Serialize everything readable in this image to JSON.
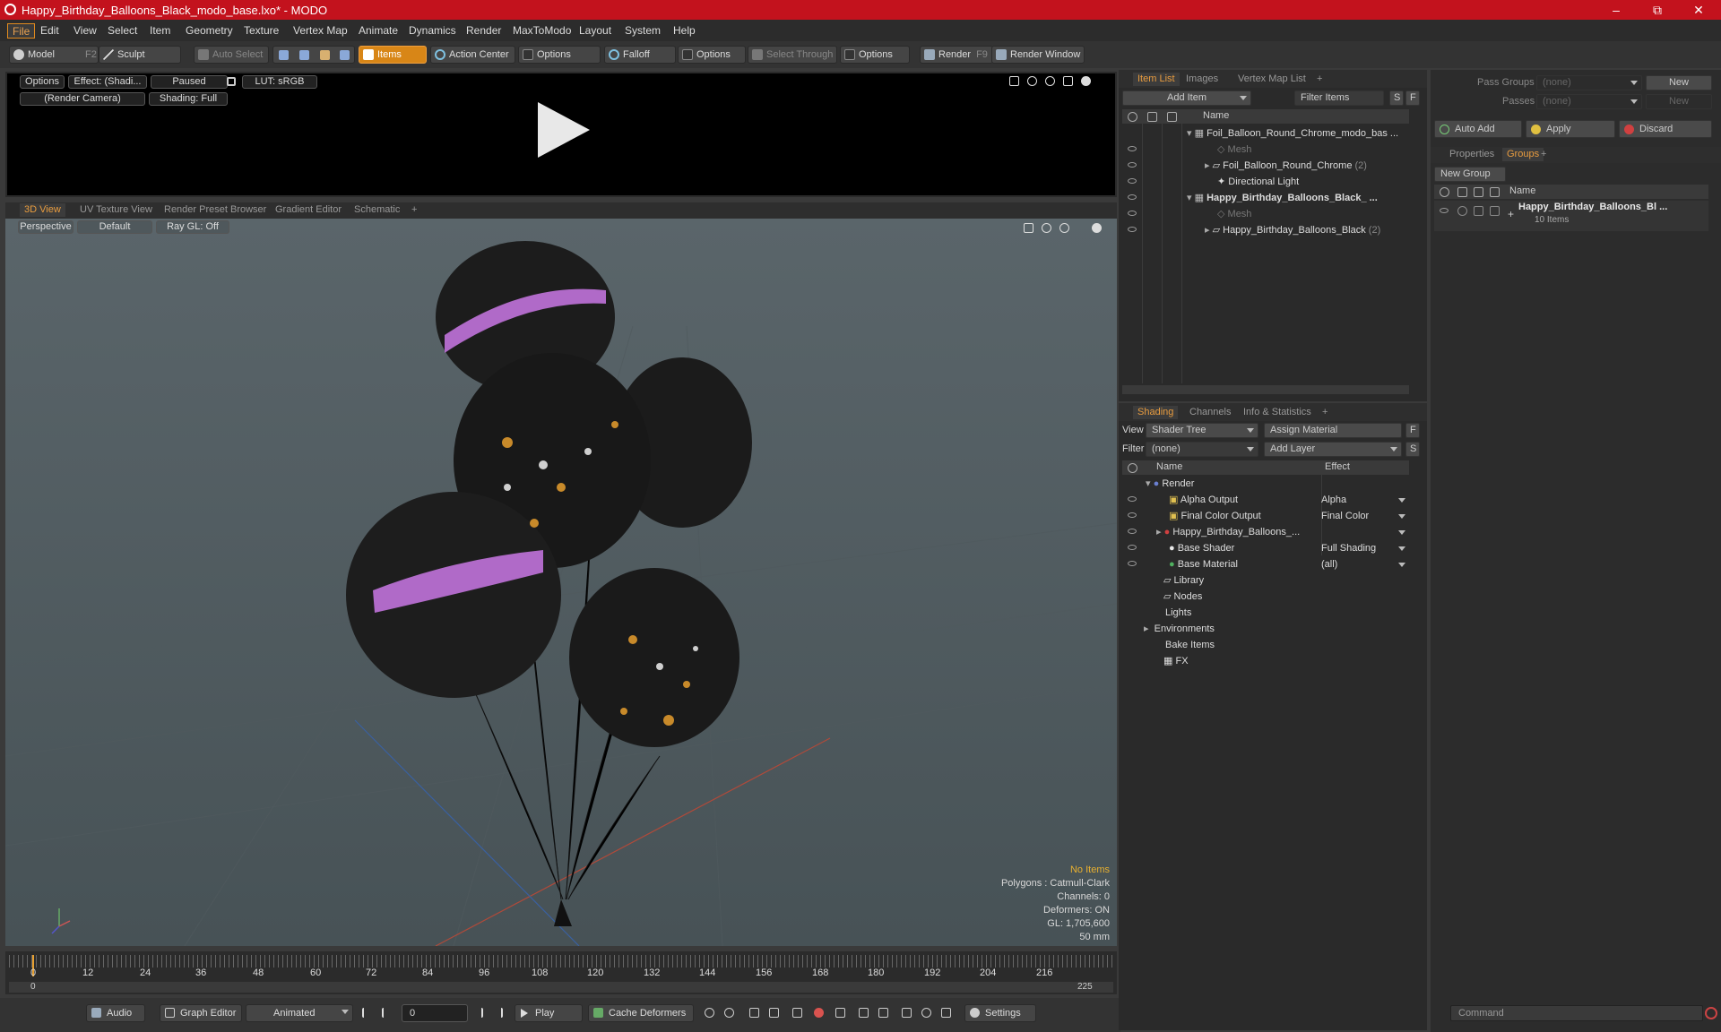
{
  "window": {
    "title": "Happy_Birthday_Balloons_Black_modo_base.lxo* - MODO",
    "min": "–",
    "max": "⧉",
    "close": "✕"
  },
  "menubar": [
    "File",
    "Edit",
    "View",
    "Select",
    "Item",
    "Geometry",
    "Texture",
    "Vertex Map",
    "Animate",
    "Dynamics",
    "Render",
    "MaxToModo",
    "Layout",
    "System",
    "Help"
  ],
  "toolbar": {
    "model": "Model",
    "model_key": "F2",
    "sculpt": "Sculpt",
    "auto_select": "Auto Select",
    "items": "Items",
    "action_center": "Action Center",
    "options1": "Options",
    "falloff": "Falloff",
    "options2": "Options",
    "select_through": "Select Through",
    "options3": "Options",
    "render": "Render",
    "render_key": "F9",
    "render_window": "Render Window"
  },
  "preview": {
    "options": "Options",
    "effect": "Effect: (Shadi...",
    "paused": "Paused",
    "lut": "LUT: sRGB",
    "camera": "(Render Camera)",
    "shading": "Shading: Full"
  },
  "viewport_tabs": [
    "3D View",
    "UV Texture View",
    "Render Preset Browser",
    "Gradient Editor",
    "Schematic",
    "+"
  ],
  "viewport": {
    "perspective": "Perspective",
    "default": "Default",
    "raygl": "Ray GL: Off",
    "no_items": "No Items",
    "polygons": "Polygons : Catmull-Clark",
    "channels": "Channels: 0",
    "deformers": "Deformers: ON",
    "gl": "GL: 1,705,600",
    "focal": "50 mm"
  },
  "timeline": {
    "ticks": [
      "0",
      "12",
      "24",
      "36",
      "48",
      "60",
      "72",
      "84",
      "96",
      "108",
      "120",
      "132",
      "144",
      "156",
      "168",
      "180",
      "192",
      "204",
      "216"
    ],
    "start": "0",
    "end": "225",
    "end_top": "225"
  },
  "bottom": {
    "audio": "Audio",
    "graph_editor": "Graph Editor",
    "animated": "Animated",
    "frame": "0",
    "play": "Play",
    "cache": "Cache Deformers",
    "settings": "Settings"
  },
  "item_list": {
    "tabs": [
      "Item List",
      "Images",
      "Vertex Map List",
      "+"
    ],
    "add_item": "Add Item",
    "filter_items": "Filter Items",
    "s": "S",
    "f": "F",
    "col_name": "Name",
    "rows": [
      {
        "label": "Foil_Balloon_Round_Chrome_modo_bas ...",
        "bold": false,
        "dim": false
      },
      {
        "label": "Mesh",
        "bold": false,
        "dim": true
      },
      {
        "label": "Foil_Balloon_Round_Chrome",
        "count": "(2)",
        "bold": false,
        "dim": false
      },
      {
        "label": "Directional Light",
        "bold": false,
        "dim": false
      },
      {
        "label": "Happy_Birthday_Balloons_Black_ ...",
        "bold": true,
        "dim": false
      },
      {
        "label": "Mesh",
        "bold": false,
        "dim": true
      },
      {
        "label": "Happy_Birthday_Balloons_Black",
        "count": "(2)",
        "bold": false,
        "dim": false
      }
    ]
  },
  "shading": {
    "tabs": [
      "Shading",
      "Channels",
      "Info & Statistics",
      "+"
    ],
    "view_label": "View",
    "view_value": "Shader Tree",
    "assign_material": "Assign Material",
    "filter_label": "Filter",
    "filter_value": "(none)",
    "add_layer": "Add Layer",
    "f": "F",
    "s": "S",
    "col_name": "Name",
    "col_effect": "Effect",
    "rows": [
      {
        "name": "Render",
        "effect": ""
      },
      {
        "name": "Alpha Output",
        "effect": "Alpha"
      },
      {
        "name": "Final Color Output",
        "effect": "Final Color"
      },
      {
        "name": "Happy_Birthday_Balloons_...",
        "effect": ""
      },
      {
        "name": "Base Shader",
        "effect": "Full Shading"
      },
      {
        "name": "Base Material",
        "effect": "(all)"
      },
      {
        "name": "Library",
        "effect": ""
      },
      {
        "name": "Nodes",
        "effect": ""
      },
      {
        "name": "Lights",
        "effect": ""
      },
      {
        "name": "Environments",
        "effect": ""
      },
      {
        "name": "Bake Items",
        "effect": ""
      },
      {
        "name": "FX",
        "effect": ""
      }
    ]
  },
  "groups": {
    "pass_groups": "Pass Groups",
    "pass_value": "(none)",
    "new1": "New",
    "passes": "Passes",
    "passes_value": "(none)",
    "new2": "New",
    "auto_add": "Auto Add",
    "apply": "Apply",
    "discard": "Discard",
    "tabs": [
      "Properties",
      "Groups",
      "+"
    ],
    "new_group": "New Group",
    "col_name": "Name",
    "group_name": "Happy_Birthday_Balloons_Bl ...",
    "group_items": "10 Items",
    "plus": "+"
  },
  "command": {
    "placeholder": "Command"
  }
}
